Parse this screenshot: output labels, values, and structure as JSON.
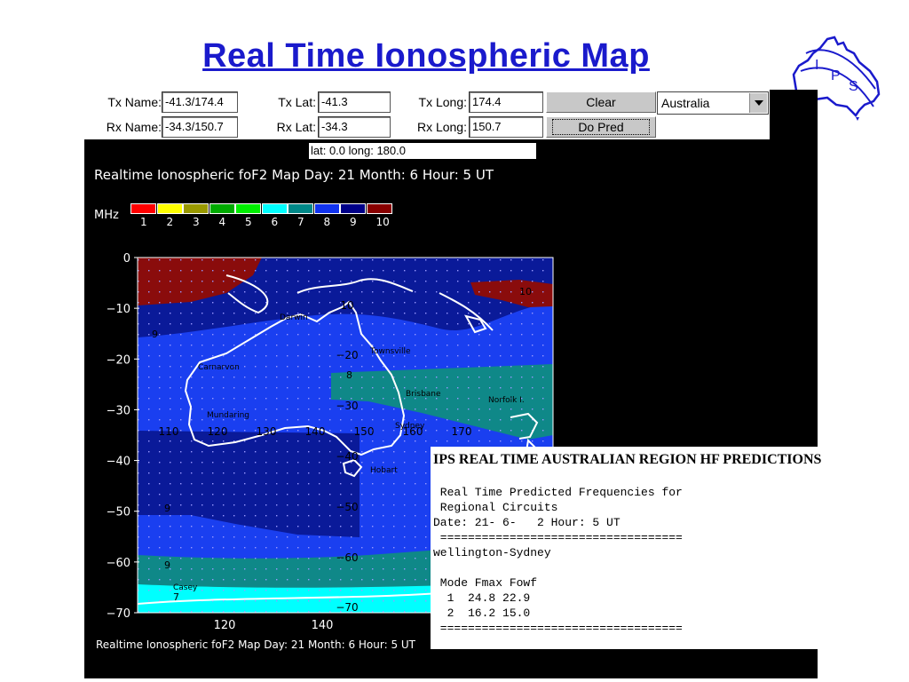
{
  "page": {
    "title": "Real Time Ionospheric Map"
  },
  "logo": {
    "text": "I P S"
  },
  "form": {
    "tx_name_label": "Tx Name:",
    "tx_name_value": "-41.3/174.4",
    "rx_name_label": "Rx Name:",
    "rx_name_value": "-34.3/150.7",
    "tx_lat_label": "Tx Lat:",
    "tx_lat_value": "-41.3",
    "rx_lat_label": "Rx Lat:",
    "rx_lat_value": "-34.3",
    "tx_long_label": "Tx Long:",
    "tx_long_value": "174.4",
    "rx_long_label": "Rx Long:",
    "rx_long_value": "150.7",
    "clear_label": "Clear",
    "do_pred_label": "Do Pred",
    "region_selected": "Australia"
  },
  "coord_readout": "lat: 0.0 long: 180.0",
  "map": {
    "header": "Realtime Ionospheric foF2 Map Day: 21 Month: 6 Hour: 5 UT",
    "footer": "Realtime Ionospheric foF2 Map Day: 21 Month: 6 Hour: 5 UT",
    "legend_unit": "MHz",
    "legend": [
      {
        "label": "1",
        "color": "#ff0000"
      },
      {
        "label": "2",
        "color": "#ffff00"
      },
      {
        "label": "3",
        "color": "#999900"
      },
      {
        "label": "4",
        "color": "#00aa00"
      },
      {
        "label": "5",
        "color": "#00ee00"
      },
      {
        "label": "6",
        "color": "#00ffff"
      },
      {
        "label": "7",
        "color": "#008888"
      },
      {
        "label": "8",
        "color": "#1133ee"
      },
      {
        "label": "9",
        "color": "#000088"
      },
      {
        "label": "10",
        "color": "#880000"
      }
    ],
    "y_ticks": [
      "0",
      "−10",
      "−20",
      "−30",
      "−40",
      "−50",
      "−60",
      "−70"
    ],
    "x_ticks_bottom": [
      "120",
      "140"
    ],
    "x_ticks_inner": [
      "110",
      "120",
      "130",
      "140",
      "150",
      "160",
      "170"
    ],
    "inner_lat_labels": [
      "10",
      "−20",
      "−30",
      "−40",
      "−50",
      "−60",
      "−70"
    ],
    "places": [
      "Darwin",
      "Townsville",
      "Carnarvon",
      "Brisbane",
      "Norfolk I.",
      "Mundaring",
      "Sydney",
      "Hobart",
      "Casey"
    ],
    "contour_labels": [
      "10",
      "9",
      "8",
      "9",
      "9",
      "7"
    ]
  },
  "predictions": {
    "title": "IPS REAL TIME AUSTRALIAN REGION HF PREDICTIONS",
    "lines": [
      " Real Time Predicted Frequencies for",
      " Regional Circuits",
      "Date: 21- 6-   2 Hour: 5 UT",
      " ===================================",
      "wellington-Sydney",
      "",
      " Mode Fmax Fowf",
      "  1  24.8 22.9",
      "  2  16.2 15.0",
      " ==================================="
    ]
  }
}
